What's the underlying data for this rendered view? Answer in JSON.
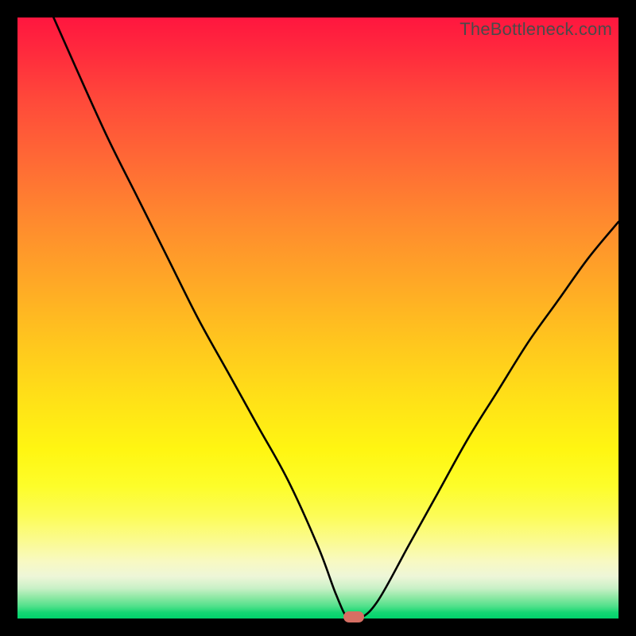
{
  "watermark": "TheBottleneck.com",
  "colors": {
    "frame": "#000000",
    "curve": "#000000",
    "marker": "#d66f63"
  },
  "chart_data": {
    "type": "line",
    "title": "",
    "xlabel": "",
    "ylabel": "",
    "xlim": [
      0,
      100
    ],
    "ylim": [
      0,
      100
    ],
    "grid": false,
    "legend": false,
    "series": [
      {
        "name": "bottleneck-curve",
        "x": [
          6,
          10,
          15,
          20,
          25,
          30,
          35,
          40,
          45,
          50,
          53,
          55,
          57,
          60,
          65,
          70,
          75,
          80,
          85,
          90,
          95,
          100
        ],
        "y": [
          100,
          91,
          80,
          70,
          60,
          50,
          41,
          32,
          23,
          12,
          4,
          0,
          0,
          3,
          12,
          21,
          30,
          38,
          46,
          53,
          60,
          66
        ]
      }
    ],
    "marker": {
      "x": 56,
      "y": 0
    }
  }
}
